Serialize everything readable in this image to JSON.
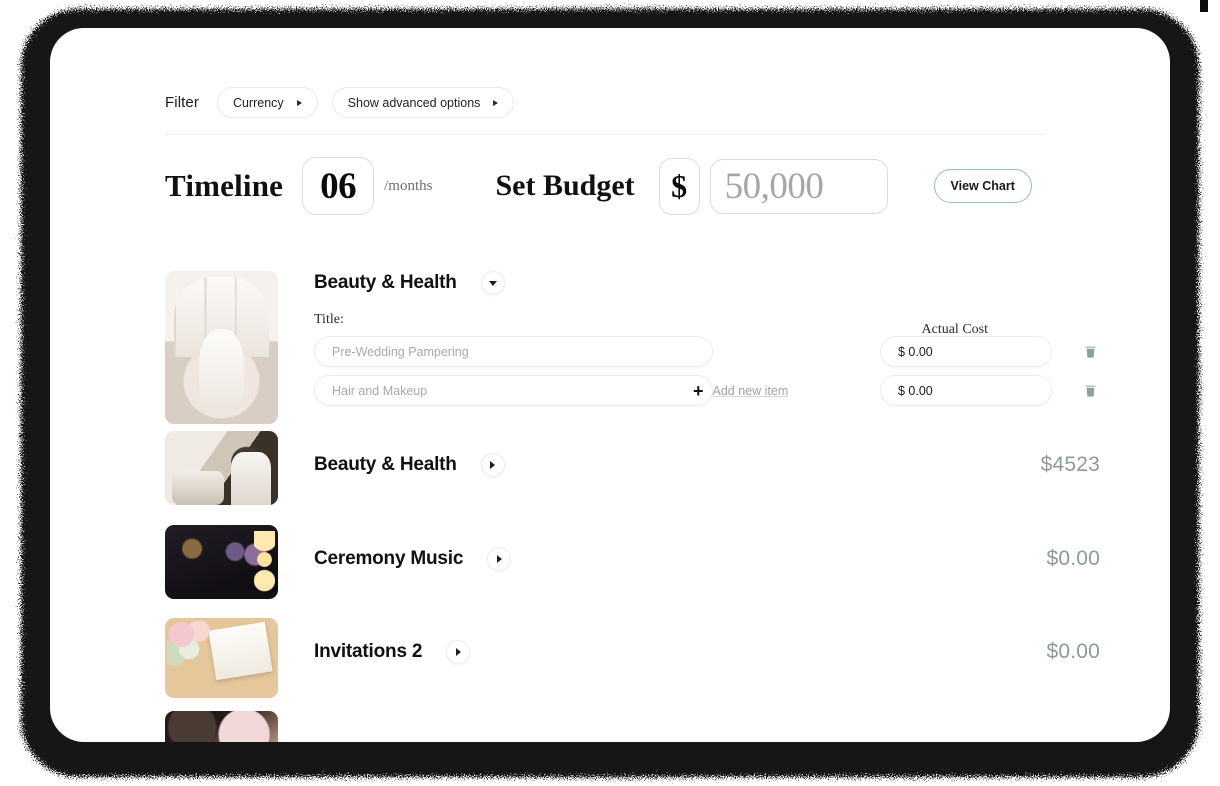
{
  "filter": {
    "label": "Filter",
    "chips": [
      {
        "label": "Currency",
        "icon": "caret-right-icon"
      },
      {
        "label": "Show advanced options",
        "icon": "caret-right-icon"
      }
    ]
  },
  "controls": {
    "timeline_title": "Timeline",
    "months_value": "06",
    "months_unit": "/months",
    "budget_title": "Set Budget",
    "currency_symbol": "$",
    "budget_placeholder": "50,000",
    "view_chart_label": "View Chart"
  },
  "colors": {
    "accent_green": "#93c3b0",
    "amount_sage": "#8b9c94",
    "trash_sage": "#8aa396",
    "placeholder_gray": "#a9a9a9",
    "frame_dark": "#141414"
  },
  "table_headers": {
    "title": "Title:",
    "actual_cost": "Actual Cost"
  },
  "add_item": {
    "plus": "+",
    "label": "Add new item"
  },
  "categories": [
    {
      "name": "Beauty & Health",
      "expanded": true,
      "toggle_icon": "chevron-down-icon",
      "thumbnail": "spa-bathtub-photo",
      "items": [
        {
          "title_placeholder": "Pre-Wedding Pampering",
          "cost_value": "$ 0.00",
          "delete_icon": "trash-icon"
        },
        {
          "title_placeholder": "Hair and Makeup",
          "cost_value": "$ 0.00",
          "delete_icon": "trash-icon"
        }
      ]
    },
    {
      "name": "Beauty & Health",
      "expanded": false,
      "toggle_icon": "chevron-right-icon",
      "thumbnail": "catering-bartender-photo",
      "amount": "$4523"
    },
    {
      "name": "Ceremony Music",
      "expanded": false,
      "toggle_icon": "chevron-right-icon",
      "thumbnail": "musicians-night-photo",
      "amount": "$0.00"
    },
    {
      "name": "Invitations 2",
      "expanded": false,
      "toggle_icon": "chevron-right-icon",
      "thumbnail": "wedding-invitation-photo",
      "amount": "$0.00"
    }
  ]
}
